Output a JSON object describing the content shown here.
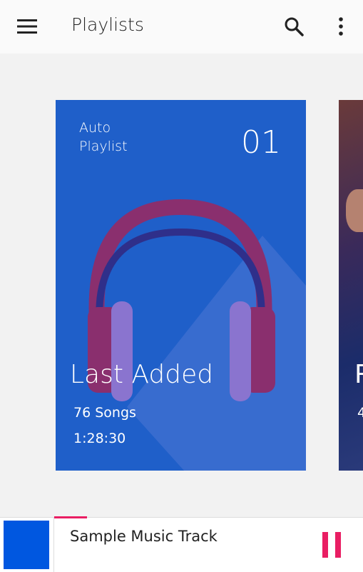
{
  "appbar": {
    "title": "Playlists",
    "icons": {
      "menu": "menu-icon",
      "search": "search-icon",
      "more": "more-vert-icon"
    }
  },
  "playlists": [
    {
      "type_label_line1": "Auto",
      "type_label_line2": "Playlist",
      "number": "01",
      "name": "Last Added",
      "songs": "76 Songs",
      "duration": "1:28:30",
      "background_color": "#1f5fc9",
      "art": "headphones"
    },
    {
      "name_visible": "R",
      "songs_visible": "4"
    }
  ],
  "now_playing": {
    "title": "Sample Music Track",
    "progress_fraction": 0.09,
    "accent_color": "#e91e63",
    "thumbnail_color": "#0057e0",
    "control_icon": "pause-icon"
  }
}
